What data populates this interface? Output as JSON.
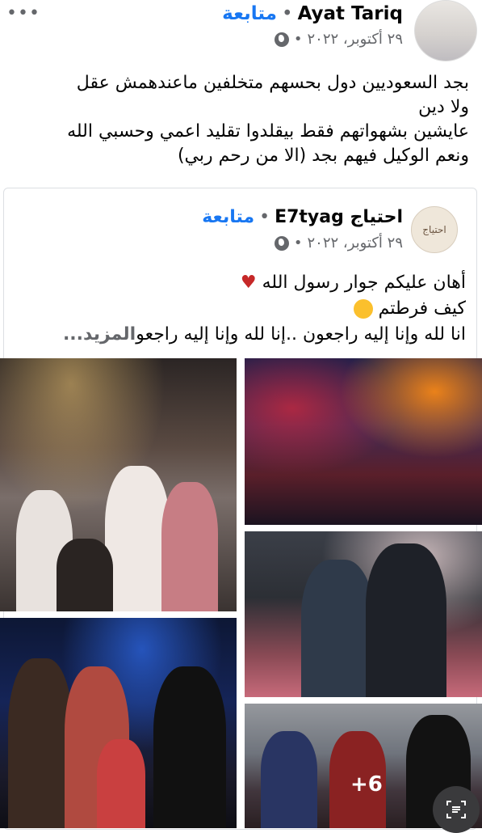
{
  "post": {
    "author": "Ayat Tariq",
    "follow_label": "متابعة",
    "date": "٢٩ أكتوبر، ٢٠٢٢",
    "text_lines": [
      "بجد السعوديين دول بحسهم متخلفين  ماعندهمش عقل",
      "ولا دين",
      "عايشين بشهواتهم فقط بيقلدوا تقليد اعمي وحسبي الله",
      "ونعم الوكيل فيهم بجد (الا من رحم ربي)"
    ]
  },
  "shared": {
    "author": "احتياج E7tyag",
    "follow_label": "متابعة",
    "date": "٢٩ أكتوبر، ٢٠٢٢",
    "avatar_text": "احتياج",
    "text_lines": [
      "أهان عليكم جوار رسول الله",
      "كيف فرطتم",
      "انا لله وإنا إليه راجعون ..إنا لله وإنا إليه راجعو"
    ],
    "see_more": "المزيد...",
    "more_photos": "+6"
  },
  "icons": {
    "more": "more-dots-icon",
    "globe": "globe-icon",
    "broken_heart": "broken-heart-icon",
    "sad": "sad-face-icon",
    "scan": "text-scan-icon"
  },
  "colors": {
    "link": "#1877f2",
    "muted": "#65676b"
  }
}
